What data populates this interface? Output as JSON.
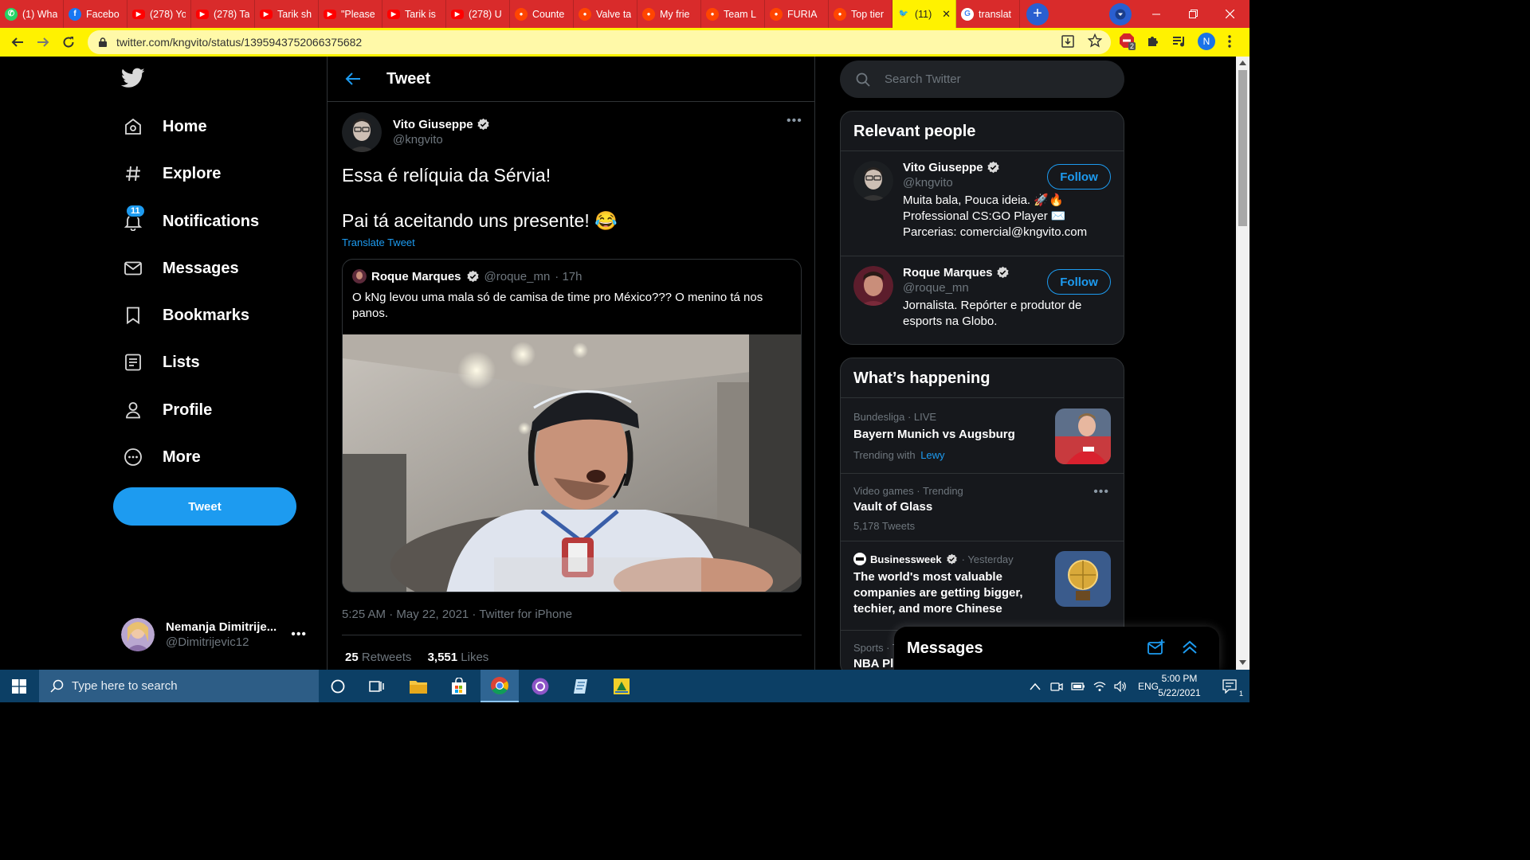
{
  "browser": {
    "tabs": [
      {
        "title": "(1) Wha",
        "icon": "whatsapp-icon",
        "color": "#25d366"
      },
      {
        "title": "Facebo",
        "icon": "facebook-icon",
        "color": "#1877f2"
      },
      {
        "title": "(278) Yo",
        "icon": "youtube-icon",
        "color": "#ff0000"
      },
      {
        "title": "(278) Ta",
        "icon": "youtube-icon",
        "color": "#ff0000"
      },
      {
        "title": "Tarik sh",
        "icon": "youtube-icon",
        "color": "#ff0000"
      },
      {
        "title": "\"Please",
        "icon": "youtube-icon",
        "color": "#ff0000"
      },
      {
        "title": "Tarik is",
        "icon": "youtube-icon",
        "color": "#ff0000"
      },
      {
        "title": "(278) U",
        "icon": "youtube-icon",
        "color": "#ff0000"
      },
      {
        "title": "Counte",
        "icon": "reddit-icon",
        "color": "#ff4500"
      },
      {
        "title": "Valve ta",
        "icon": "reddit-icon",
        "color": "#ff4500"
      },
      {
        "title": "My frie",
        "icon": "reddit-icon",
        "color": "#ff4500"
      },
      {
        "title": "Team L",
        "icon": "reddit-icon",
        "color": "#ff4500"
      },
      {
        "title": "FURIA",
        "icon": "reddit-icon",
        "color": "#ff4500"
      },
      {
        "title": "Top tier",
        "icon": "reddit-icon",
        "color": "#ff4500"
      },
      {
        "title": "(11)",
        "icon": "twitter-icon",
        "color": "#1d9bf0",
        "active": true
      },
      {
        "title": "translat",
        "icon": "google-icon",
        "color": "#4285f4"
      }
    ],
    "url": "twitter.com/kngvito/status/1395943752066375682",
    "extension_badge": "2",
    "profile_initial": "N"
  },
  "nav": {
    "home": "Home",
    "explore": "Explore",
    "notifications": "Notifications",
    "notifications_badge": "11",
    "messages": "Messages",
    "bookmarks": "Bookmarks",
    "lists": "Lists",
    "profile": "Profile",
    "more": "More",
    "tweet_button": "Tweet"
  },
  "account": {
    "name": "Nemanja Dimitrije...",
    "handle": "@Dimitrijevic12"
  },
  "tweet": {
    "header_title": "Tweet",
    "author_name": "Vito Giuseppe",
    "author_handle": "@kngvito",
    "line1": "Essa é relíquia da Sérvia!",
    "line2": "Pai tá aceitando uns presente! 😂",
    "translate": "Translate Tweet",
    "timestamp": "5:25 AM · May 22, 2021 · Twitter for iPhone",
    "retweets": "25",
    "retweets_label": "Retweets",
    "likes": "3,551",
    "likes_label": "Likes",
    "quote": {
      "author_name": "Roque Marques",
      "author_handle": "@roque_mn",
      "time": "· 17h",
      "text": "O kNg levou uma mala só de camisa de time pro México??? O menino tá nos panos."
    }
  },
  "sidebar": {
    "search_placeholder": "Search Twitter",
    "relevant_title": "Relevant people",
    "people": [
      {
        "name": "Vito Giuseppe",
        "handle": "@kngvito",
        "bio": "Muita bala, Pouca ideia. 🚀🔥 Professional CS:GO Player ✉️ Parcerias: comercial@kngvito.com",
        "follow": "Follow"
      },
      {
        "name": "Roque Marques",
        "handle": "@roque_mn",
        "bio": "Jornalista. Repórter e produtor de esports na Globo.",
        "follow": "Follow"
      }
    ],
    "happening_title": "What’s happening",
    "trends": [
      {
        "category": "Bundesliga · LIVE",
        "title": "Bayern Munich vs Augsburg",
        "sub_prefix": "Trending with",
        "sub_link": "Lewy"
      },
      {
        "category": "Video games · Trending",
        "title": "Vault of Glass",
        "sub": "5,178 Tweets"
      },
      {
        "category": "Businessweek",
        "category_time": "· Yesterday",
        "title": "The world's most valuable companies are getting bigger, techier, and more Chinese"
      },
      {
        "category": "Sports · T",
        "title": "NBA Pl"
      }
    ],
    "messages_dock": "Messages"
  },
  "taskbar": {
    "search_placeholder": "Type here to search",
    "language": "ENG",
    "time": "5:00 PM",
    "date": "5/22/2021",
    "notification_count": "1"
  }
}
